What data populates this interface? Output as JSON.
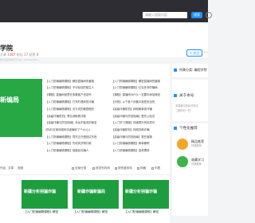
{
  "top_bar": {
    "search_placeholder": "请输入搜索内容",
    "search_button": "搜索",
    "help": "?"
  },
  "site": {
    "title": "学院",
    "articles_label": "文章",
    "articles_value": "1387",
    "fans_label": "粉丝",
    "fans_value": "17",
    "likes_label": "获赞",
    "likes_value": "0",
    "description": "成为最好的学习平台 - Amitapublic",
    "follow_button": "+ 关注",
    "more": "···"
  },
  "banner": {
    "text": "新编局"
  },
  "news_left": [
    "【入门防骗编辑课程】解密直播间的套路",
    "【入门防骗编辑课程】不可轻信的陌生人",
    "【课程】直播间就是在收集客户信息吗",
    "【入门防骗编辑课程】打车时遇到的诈骗",
    "【入门防骗编辑课程】对方说的都是假的",
    "【高级诈骗防范】冒名领取救济款",
    "【高级诈骗与防范指南】永远不能说的秘密",
    "(防诈)在家网络码流波骗你了个(小心)",
    "【入门防骗编辑课程】同学正在借钱买东西",
    "【入门防骗编辑课程】先收到货再付款",
    "【入门防骗编辑课程】保健品也骗人"
  ],
  "news_right": [
    "【入门防骗编辑课程】解密直播间的套路",
    "【入门防骗编辑课程】红包多多的骗局",
    "【课程】直播间为什么一定要你添加微信",
    "【识别】以下各个设备中谁是安全的",
    "【高级诈骗防范】网络刷单类诈骗",
    "【高级诈骗与防范指南】冒充公检法",
    "【入门学习课程】快速提升风险意识",
    "【高级诈骗防范】网络贷款诈骗",
    "【高级诈骗与防范指南】冒充客服",
    "【入门防骗编辑课程】刷单兼职",
    "【入门防骗编辑课程】投资理财"
  ],
  "filter": {
    "tabs": [
      "作品",
      "文章",
      "视频"
    ],
    "opt1": "全部分类",
    "opt2": "按发布时间",
    "opt3": "按热度排序",
    "opt4": "网格",
    "opt5": "列表"
  },
  "cards": [
    {
      "thumb": "新疆分析拐骗诈骗",
      "title": "【入门防骗编辑课程】解密"
    },
    {
      "thumb": "新疆诈骗新骗局",
      "title": "【入门防骗编辑课程】解密"
    },
    {
      "thumb": "新疆分析拐骗诈骗",
      "title": "【入门防骗编辑课程】解密"
    }
  ],
  "side": {
    "owner_label": "所属分类: 编程学院",
    "about_label": "关于本号",
    "about_text": "本课程中的反诈知识",
    "qr_label": "二维码扫一扫",
    "recommend_label": "个性化推荐",
    "rec1": "精品推荐",
    "rec1_sub": "好课推荐",
    "rec2": "收藏学习",
    "rec2_sub": "好课推荐"
  },
  "colors": {
    "topbar": "#2d2d33",
    "accent": "#1e90ff",
    "banner": "#28a745"
  }
}
